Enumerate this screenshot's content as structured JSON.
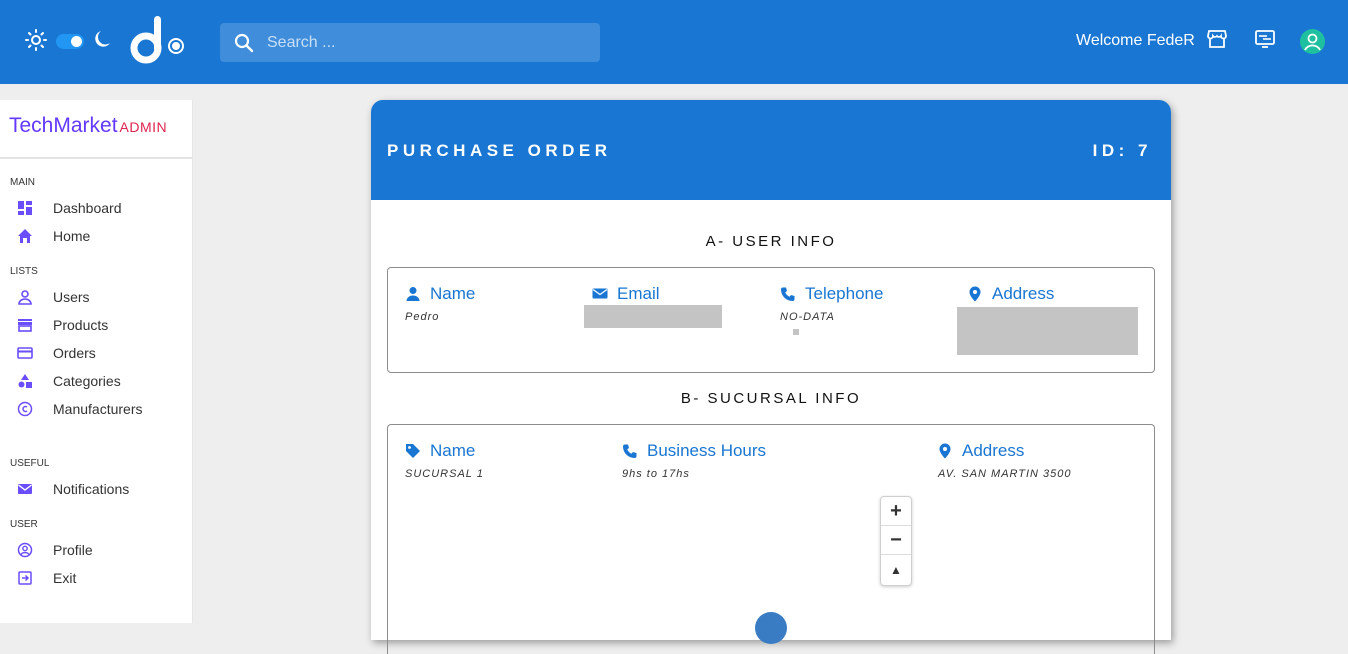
{
  "topbar": {
    "search_placeholder": "Search ...",
    "welcome": "Welcome FedeR",
    "icons": [
      "sun-icon",
      "theme-toggle",
      "moon-icon",
      "logo",
      "search-icon",
      "store-icon",
      "monitor-icon",
      "user-icon"
    ],
    "color": "#1976d2"
  },
  "sidebar": {
    "brand": "TechMarket",
    "brand_sub": "ADMIN",
    "sections": {
      "main": "MAIN",
      "lists": "LISTS",
      "useful": "USEFUL",
      "user": "USER"
    },
    "items": {
      "dashboard": "Dashboard",
      "home": "Home",
      "users": "Users",
      "products": "Products",
      "orders": "Orders",
      "categories": "Categories",
      "manufacturers": "Manufacturers",
      "notifications": "Notifications",
      "profile": "Profile",
      "exit": "Exit"
    },
    "accent": "#6439ff"
  },
  "order": {
    "title": "PURCHASE ORDER",
    "id": "ID: 7",
    "user_info": {
      "heading": "A- USER INFO",
      "name_label": "Name",
      "name_value": "Pedro",
      "email_label": "Email",
      "telephone_label": "Telephone",
      "telephone_value": "NO-DATA",
      "address_label": "Address"
    },
    "sucursal_info": {
      "heading": "B- SUCURSAL INFO",
      "name_label": "Name",
      "name_value": "SUCURSAL 1",
      "hours_label": "Business Hours",
      "hours_value": "9hs to 17hs",
      "address_label": "Address",
      "address_value": "AV. SAN MARTIN 3500"
    },
    "map": {
      "zoom_in": "+",
      "zoom_out": "−",
      "compass": "▲"
    }
  }
}
